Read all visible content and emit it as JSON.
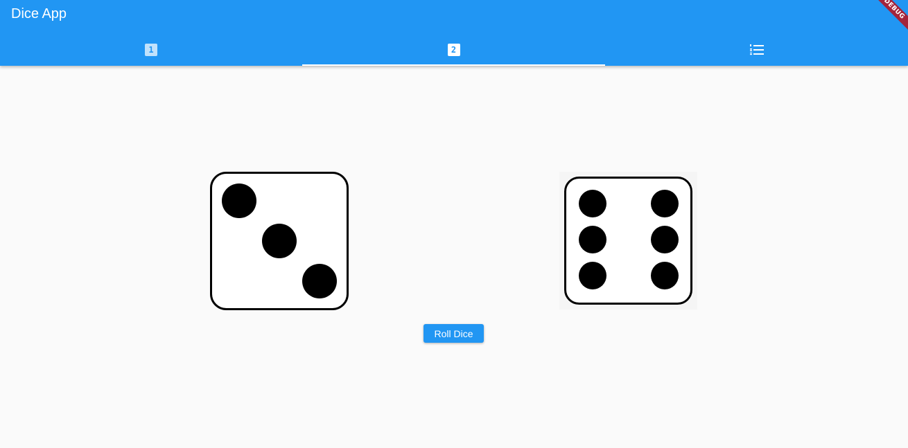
{
  "app": {
    "title": "Dice App",
    "debug_banner": "DEBUG"
  },
  "tabs": [
    {
      "icon": "looks-one-icon",
      "glyph": "1",
      "selected": false
    },
    {
      "icon": "looks-two-icon",
      "glyph": "2",
      "selected": true
    },
    {
      "icon": "format-list-numbered-icon",
      "selected": false
    }
  ],
  "dice": [
    {
      "value": 3
    },
    {
      "value": 6
    }
  ],
  "actions": {
    "roll_label": "Roll Dice"
  },
  "colors": {
    "primary": "#2196f3",
    "background": "#fafafa",
    "debug_banner": "#a3243c"
  }
}
